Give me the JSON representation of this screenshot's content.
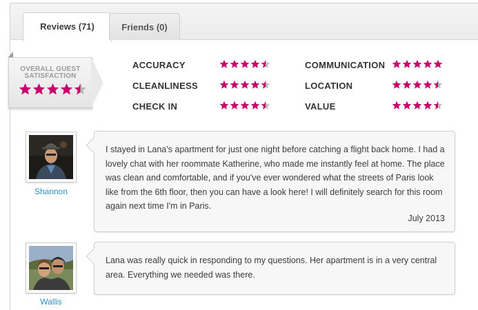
{
  "tabs": [
    {
      "label": "Reviews (71)",
      "active": true
    },
    {
      "label": "Friends (0)",
      "active": false
    }
  ],
  "overall": {
    "title_line1": "OVERALL GUEST",
    "title_line2": "SATISFACTION",
    "rating": 4.5,
    "max": 5
  },
  "categories": [
    {
      "label": "ACCURACY",
      "rating": 4.5
    },
    {
      "label": "CLEANLINESS",
      "rating": 4.5
    },
    {
      "label": "CHECK IN",
      "rating": 4.5
    },
    {
      "label": "COMMUNICATION",
      "rating": 5
    },
    {
      "label": "LOCATION",
      "rating": 4.5
    },
    {
      "label": "VALUE",
      "rating": 4.5
    }
  ],
  "reviews": [
    {
      "name": "Shannon",
      "text": "I stayed in Lana's apartment for just one night before catching a flight back home. I had a lovely chat with her roommate Katherine, who made me instantly feel at home. The place was clean and comfortable, and if you've ever wondered what the streets of Paris look like from the 6th floor, then you can have a look here! I will definitely search for this room again next time I'm in Paris.",
      "date": "July 2013"
    },
    {
      "name": "Wallis",
      "text": "Lana was really quick in responding to my questions. Her apartment is in a very central area. Everything we needed was there.",
      "date": ""
    }
  ],
  "colors": {
    "star_filled": "#c8006e",
    "star_empty": "#b9b9b9",
    "link": "#2b8fbf"
  },
  "icons": {
    "star": "star-icon",
    "half_star": "half-star-icon"
  }
}
